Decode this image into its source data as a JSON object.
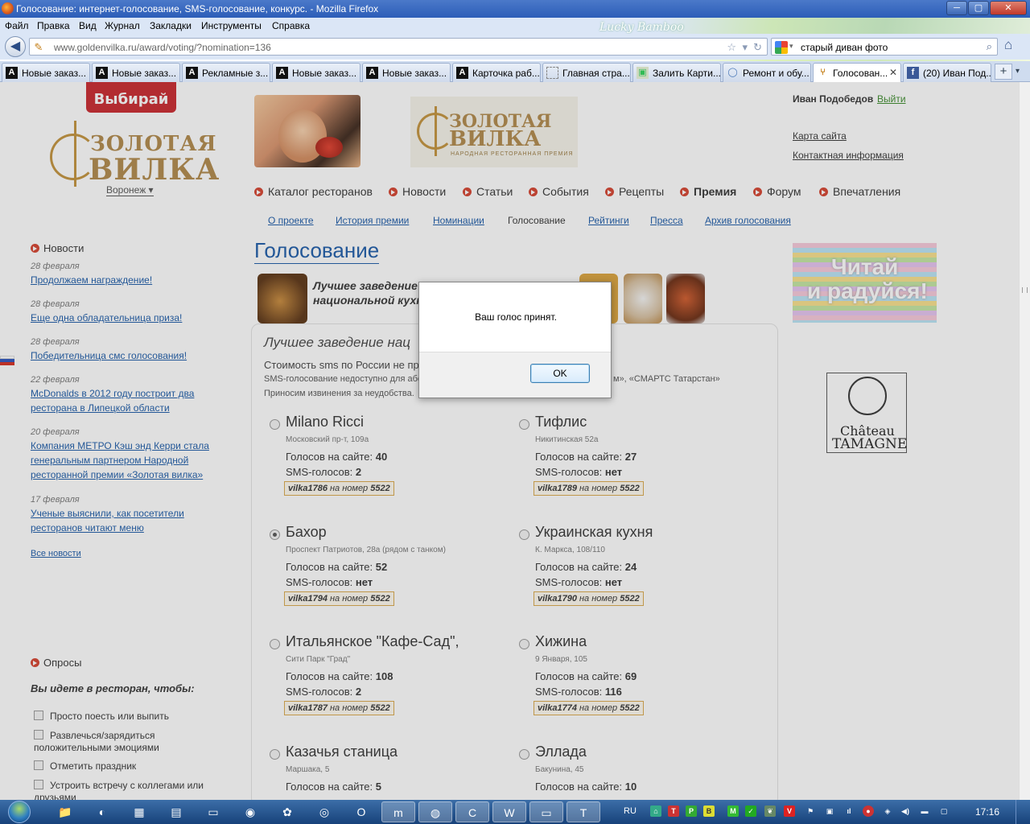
{
  "window": {
    "title": "Голосование: интернет-голосование, SMS-голосование, конкурс. - Mozilla Firefox",
    "btn_minimize": "─",
    "btn_maximize": "▢",
    "btn_close": "✕"
  },
  "menu": [
    "Файл",
    "Правка",
    "Вид",
    "Журнал",
    "Закладки",
    "Инструменты",
    "Справка"
  ],
  "nav": {
    "url": "www.goldenvilka.ru/award/voting/?nomination=136",
    "search": "старый диван фото",
    "persona": "Lucky Bamboo"
  },
  "tabs": [
    {
      "label": "Новые заказ...",
      "icon": "A"
    },
    {
      "label": "Новые заказ...",
      "icon": "A"
    },
    {
      "label": "Рекламные з...",
      "icon": "A"
    },
    {
      "label": "Новые заказ...",
      "icon": "A"
    },
    {
      "label": "Новые заказ...",
      "icon": "A"
    },
    {
      "label": "Карточка раб...",
      "icon": "A"
    },
    {
      "label": "Главная стра...",
      "icon": ""
    },
    {
      "label": "Залить Карти...",
      "icon": "▣"
    },
    {
      "label": "Ремонт и обу...",
      "icon": "◯"
    },
    {
      "label": "Голосован...",
      "icon": "⑂"
    },
    {
      "label": "(20) Иван Под...",
      "icon": "f"
    }
  ],
  "site": {
    "vybirai": "Выбирай",
    "logo_line1": "ЗОЛОТАЯ",
    "logo_line2": "ВИЛКА",
    "city": "Воронеж ▾",
    "banner_logo1": "ЗОЛОТАЯ",
    "banner_logo2": "ВИЛКА",
    "banner_logo3": "НАРОДНАЯ РЕСТОРАННАЯ ПРЕМИЯ",
    "user": "Иван Подобедов",
    "logout": "Выйти",
    "sitemap": "Карта сайта",
    "contacts": "Контактная информация"
  },
  "mainnav": [
    "Каталог ресторанов",
    "Новости",
    "Статьи",
    "События",
    "Рецепты",
    "Премия",
    "Форум",
    "Впечатления"
  ],
  "subnav": [
    "О проекте",
    "История премии",
    "Номинации",
    "Голосование",
    "Рейтинги",
    "Пресса",
    "Архив голосования"
  ],
  "page_title": "Голосование",
  "news": {
    "title": "Новости",
    "items": [
      {
        "date": "28 февраля",
        "text": "Продолжаем награждение!"
      },
      {
        "date": "28 февраля",
        "text": "Еще одна обладательница приза!"
      },
      {
        "date": "28 февраля",
        "text": "Победительница смс голосования!"
      },
      {
        "date": "22 февраля",
        "text": "McDonalds в 2012 году построит два ресторана в Липецкой области"
      },
      {
        "date": "20 февраля",
        "text": "Компания МЕТРО Кэш энд Керри стала генеральным партнером Народной ресторанной премии «Золотая вилка»"
      },
      {
        "date": "17 февраля",
        "text": "Ученые выяснили, как посетители ресторанов читают меню"
      }
    ],
    "all": "Все новости"
  },
  "poll": {
    "title": "Опросы",
    "question": "Вы идете в ресторан, чтобы:",
    "options": [
      "Просто поесть или выпить",
      "Развлечься/зарядиться положительными эмоциями",
      "Отметить праздник",
      "Устроить встречу с коллегами или друзьями"
    ]
  },
  "nomination": {
    "title_short": "Лучшее заведение национальной кухни",
    "heading": "Лучшее заведение нац",
    "sms_cost": "Стоимость sms по России не пр",
    "sms_note1": "SMS-голосование недоступно для або",
    "sms_note1_tail": "м», «СМАРТС Татарстан»",
    "sms_note2": "Приносим извинения за неудобства."
  },
  "restaurants": [
    {
      "name": "Milano Ricci",
      "addr": "Московский пр-т, 109а",
      "votes_label": "Голосов на сайте:",
      "votes": "40",
      "sms_label": "SMS-голосов:",
      "sms": "2",
      "code": "vilka1786",
      "code_mid": "на номер",
      "number": "5522",
      "selected": false
    },
    {
      "name": "Тифлис",
      "addr": "Никитинская 52а",
      "votes_label": "Голосов на сайте:",
      "votes": "27",
      "sms_label": "SMS-голосов:",
      "sms": "нет",
      "code": "vilka1789",
      "code_mid": "на номер",
      "number": "5522",
      "selected": false
    },
    {
      "name": "Бахор",
      "addr": "Проспект Патриотов, 28а (рядом с танком)",
      "votes_label": "Голосов на сайте:",
      "votes": "52",
      "sms_label": "SMS-голосов:",
      "sms": "нет",
      "code": "vilka1794",
      "code_mid": "на номер",
      "number": "5522",
      "selected": true
    },
    {
      "name": "Украинская кухня",
      "addr": "К. Маркса, 108/110",
      "votes_label": "Голосов на сайте:",
      "votes": "24",
      "sms_label": "SMS-голосов:",
      "sms": "нет",
      "code": "vilka1790",
      "code_mid": "на номер",
      "number": "5522",
      "selected": false
    },
    {
      "name": "Итальянское \"Кафе-Сад\",",
      "addr": "Сити Парк \"Град\"",
      "votes_label": "Голосов на сайте:",
      "votes": "108",
      "sms_label": "SMS-голосов:",
      "sms": "2",
      "code": "vilka1787",
      "code_mid": "на номер",
      "number": "5522",
      "selected": false
    },
    {
      "name": "Хижина",
      "addr": "9 Января, 105",
      "votes_label": "Голосов на сайте:",
      "votes": "69",
      "sms_label": "SMS-голосов:",
      "sms": "116",
      "code": "vilka1774",
      "code_mid": "на номер",
      "number": "5522",
      "selected": false
    },
    {
      "name": "Казачья станица",
      "addr": "Маршака, 5",
      "votes_label": "Голосов на сайте:",
      "votes": "5",
      "sms_label": "",
      "sms": "",
      "code": "",
      "code_mid": "",
      "number": "",
      "selected": false
    },
    {
      "name": "Эллада",
      "addr": "Бакунина, 45",
      "votes_label": "Голосов на сайте:",
      "votes": "10",
      "sms_label": "",
      "sms": "",
      "code": "",
      "code_mid": "",
      "number": "",
      "selected": false
    }
  ],
  "ads": {
    "rainbow1": "Читай",
    "rainbow2": "и радуйся!",
    "chateau1": "Château",
    "chateau2": "TAMAGNE"
  },
  "dialog": {
    "message": "Ваш голос принят.",
    "ok": "OK"
  },
  "taskbar": {
    "lang": "RU",
    "time": "17:16"
  },
  "colors": {
    "accent": "#1a5aa8",
    "bullet": "#d5402c",
    "gold": "#b08848"
  }
}
